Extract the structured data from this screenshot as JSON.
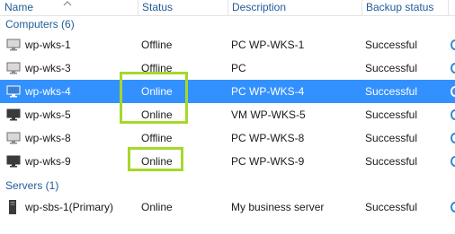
{
  "columns": {
    "name": "Name",
    "status": "Status",
    "description": "Description",
    "backup_status": "Backup status"
  },
  "groups": [
    {
      "label": "Computers (6)",
      "rows": [
        {
          "name": "wp-wks-1",
          "status": "Offline",
          "description": "PC WP-WKS-1",
          "backup": "Successful"
        },
        {
          "name": "wp-wks-3",
          "status": "Offline",
          "description": "PC",
          "backup": "Successful"
        },
        {
          "name": "wp-wks-4",
          "status": "Online",
          "description": "PC WP-WKS-4",
          "backup": "Successful"
        },
        {
          "name": "wp-wks-5",
          "status": "Online",
          "description": "VM WP-WKS-5",
          "backup": "Successful"
        },
        {
          "name": "wp-wks-8",
          "status": "Offline",
          "description": "PC WP-WKS-8",
          "backup": "Successful"
        },
        {
          "name": "wp-wks-9",
          "status": "Online",
          "description": "PC WP-WKS-9",
          "backup": "Successful"
        }
      ]
    },
    {
      "label": "Servers (1)",
      "rows": [
        {
          "name": "wp-sbs-1(Primary)",
          "status": "Online",
          "description": "My business server",
          "backup": "Successful"
        }
      ]
    }
  ],
  "colors": {
    "selection": "#3390ff",
    "highlight": "#a6d82a",
    "header_text": "#1f5b9a"
  },
  "icons": {
    "computer": "monitor-icon",
    "server": "server-tower-icon",
    "sort": "sort-ascending-icon"
  }
}
